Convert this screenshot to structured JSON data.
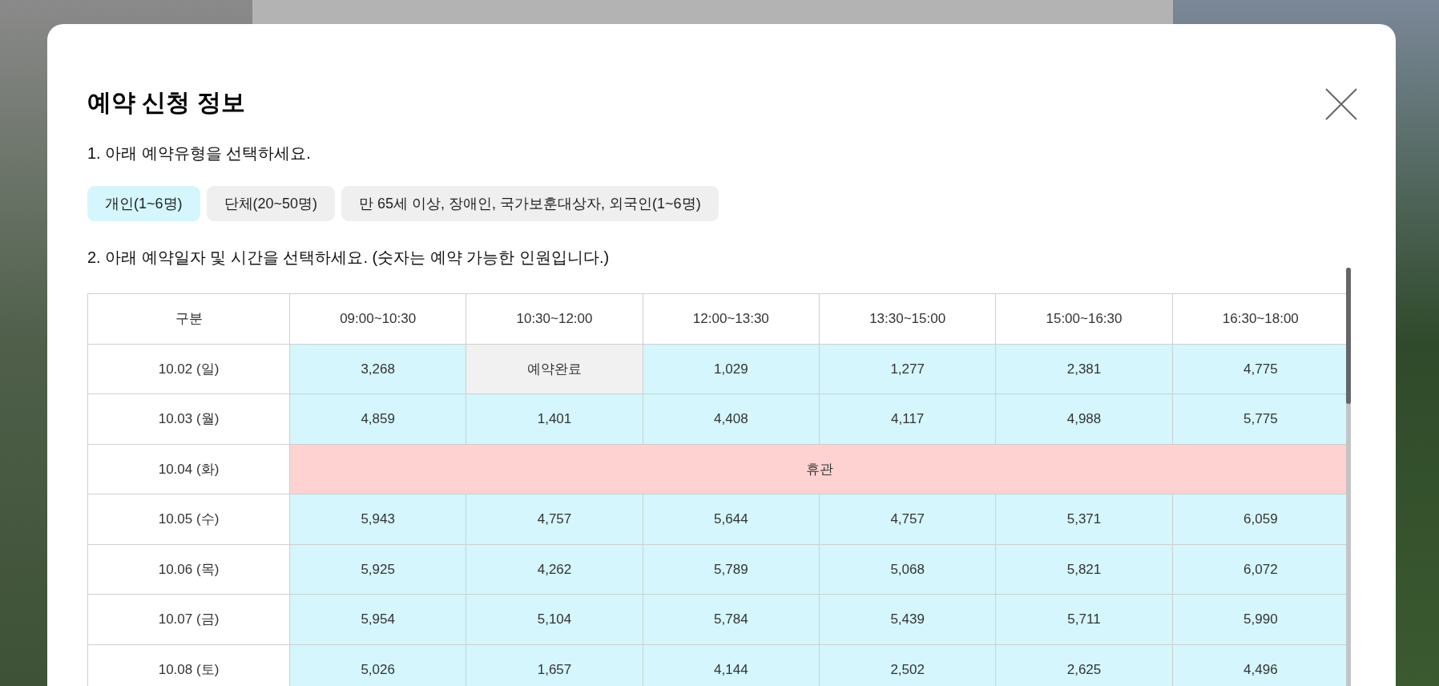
{
  "modal": {
    "title": "예약 신청 정보",
    "step_1": "1. 아래 예약유형을 선택하세요.",
    "types": [
      {
        "label": "개인(1~6명)",
        "selected": true
      },
      {
        "label": "단체(20~50명)",
        "selected": false
      },
      {
        "label": "만 65세 이상, 장애인, 국가보훈대상자, 외국인(1~6명)",
        "selected": false
      }
    ],
    "step_2": "2. 아래 예약일자 및 시간을 선택하세요. (숫자는 예약 가능한 인원입니다.)",
    "table": {
      "columns": [
        "구분",
        "09:00~10:30",
        "10:30~12:00",
        "12:00~13:30",
        "13:30~15:00",
        "15:00~16:30",
        "16:30~18:00"
      ],
      "rows": [
        {
          "date": "10.02 (일)",
          "kind": "open",
          "slots": [
            {
              "text": "3,268",
              "booked": false
            },
            {
              "text": "예약완료",
              "booked": true
            },
            {
              "text": "1,029",
              "booked": false
            },
            {
              "text": "1,277",
              "booked": false
            },
            {
              "text": "2,381",
              "booked": false
            },
            {
              "text": "4,775",
              "booked": false
            }
          ]
        },
        {
          "date": "10.03 (월)",
          "kind": "open",
          "slots": [
            {
              "text": "4,859",
              "booked": false
            },
            {
              "text": "1,401",
              "booked": false
            },
            {
              "text": "4,408",
              "booked": false
            },
            {
              "text": "4,117",
              "booked": false
            },
            {
              "text": "4,988",
              "booked": false
            },
            {
              "text": "5,775",
              "booked": false
            }
          ]
        },
        {
          "date": "10.04 (화)",
          "kind": "closed",
          "note": "휴관"
        },
        {
          "date": "10.05 (수)",
          "kind": "open",
          "slots": [
            {
              "text": "5,943",
              "booked": false
            },
            {
              "text": "4,757",
              "booked": false
            },
            {
              "text": "5,644",
              "booked": false
            },
            {
              "text": "4,757",
              "booked": false
            },
            {
              "text": "5,371",
              "booked": false
            },
            {
              "text": "6,059",
              "booked": false
            }
          ]
        },
        {
          "date": "10.06 (목)",
          "kind": "open",
          "slots": [
            {
              "text": "5,925",
              "booked": false
            },
            {
              "text": "4,262",
              "booked": false
            },
            {
              "text": "5,789",
              "booked": false
            },
            {
              "text": "5,068",
              "booked": false
            },
            {
              "text": "5,821",
              "booked": false
            },
            {
              "text": "6,072",
              "booked": false
            }
          ]
        },
        {
          "date": "10.07 (금)",
          "kind": "open",
          "slots": [
            {
              "text": "5,954",
              "booked": false
            },
            {
              "text": "5,104",
              "booked": false
            },
            {
              "text": "5,784",
              "booked": false
            },
            {
              "text": "5,439",
              "booked": false
            },
            {
              "text": "5,711",
              "booked": false
            },
            {
              "text": "5,990",
              "booked": false
            }
          ]
        },
        {
          "date": "10.08 (토)",
          "kind": "open",
          "slots": [
            {
              "text": "5,026",
              "booked": false
            },
            {
              "text": "1,657",
              "booked": false
            },
            {
              "text": "4,144",
              "booked": false
            },
            {
              "text": "2,502",
              "booked": false
            },
            {
              "text": "2,625",
              "booked": false
            },
            {
              "text": "4,496",
              "booked": false
            }
          ]
        }
      ]
    }
  }
}
